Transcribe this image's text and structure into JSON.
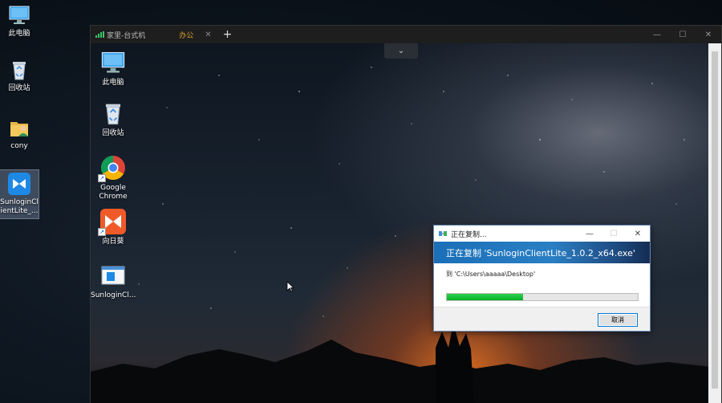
{
  "host_desktop": {
    "icons": [
      {
        "id": "this-pc",
        "label": "此电脑"
      },
      {
        "id": "recycle-bin",
        "label": "回收站"
      },
      {
        "id": "user-folder",
        "label": "cony"
      },
      {
        "id": "sunlogin-lite",
        "label": "SunloginClientLite_..."
      }
    ]
  },
  "remote_window": {
    "tabs": [
      {
        "label": "家里-台式机",
        "active": false
      },
      {
        "label": "办公",
        "active": true
      }
    ],
    "tab_close_glyph": "✕",
    "add_tab_glyph": "+",
    "controls": {
      "minimize": "—",
      "maximize": "☐",
      "close": "✕"
    },
    "collapse_glyph": "⌄",
    "desktop_icons": [
      {
        "id": "this-pc",
        "label": "此电脑"
      },
      {
        "id": "recycle-bin",
        "label": "回收站"
      },
      {
        "id": "google-chrome",
        "label": "Google Chrome"
      },
      {
        "id": "sunflower",
        "label": "向日葵"
      },
      {
        "id": "sunlogin-client",
        "label": "SunloginCl..."
      }
    ]
  },
  "copy_dialog": {
    "title": "正在复制...",
    "heading": "正在复制 'SunloginClientLite_1.0.2_x64.exe'",
    "destination": "到 'C:\\Users\\aaaaa\\Desktop'",
    "progress": 0.4,
    "cancel_label": "取消",
    "controls": {
      "minimize": "—",
      "maximize": "☐",
      "close": "✕"
    }
  },
  "colors": {
    "progress_green": "#06b025",
    "active_tab": "#e0a030",
    "dialog_banner": "#1a6fb8"
  }
}
